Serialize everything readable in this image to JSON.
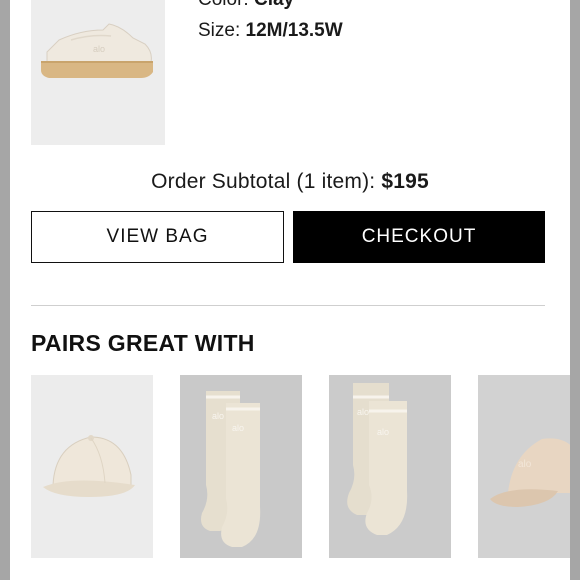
{
  "product": {
    "image_icon": "sneaker-icon",
    "color_label": "Color:",
    "color_value": "Clay",
    "size_label": "Size:",
    "size_value": "12M/13.5W"
  },
  "summary": {
    "subtotal_label": "Order Subtotal (1 item):",
    "subtotal_value": "$195"
  },
  "actions": {
    "view_bag_label": "VIEW BAG",
    "checkout_label": "CHECKOUT"
  },
  "recommendations": {
    "title": "PAIRS GREAT WITH",
    "items": [
      {
        "icon": "cap-icon"
      },
      {
        "icon": "socks-icon"
      },
      {
        "icon": "socks-icon"
      },
      {
        "icon": "cap-icon"
      }
    ]
  },
  "colors": {
    "checkout_bg": "#000000",
    "divider": "#cfcfcf",
    "overlay": "#a6a6a6"
  }
}
